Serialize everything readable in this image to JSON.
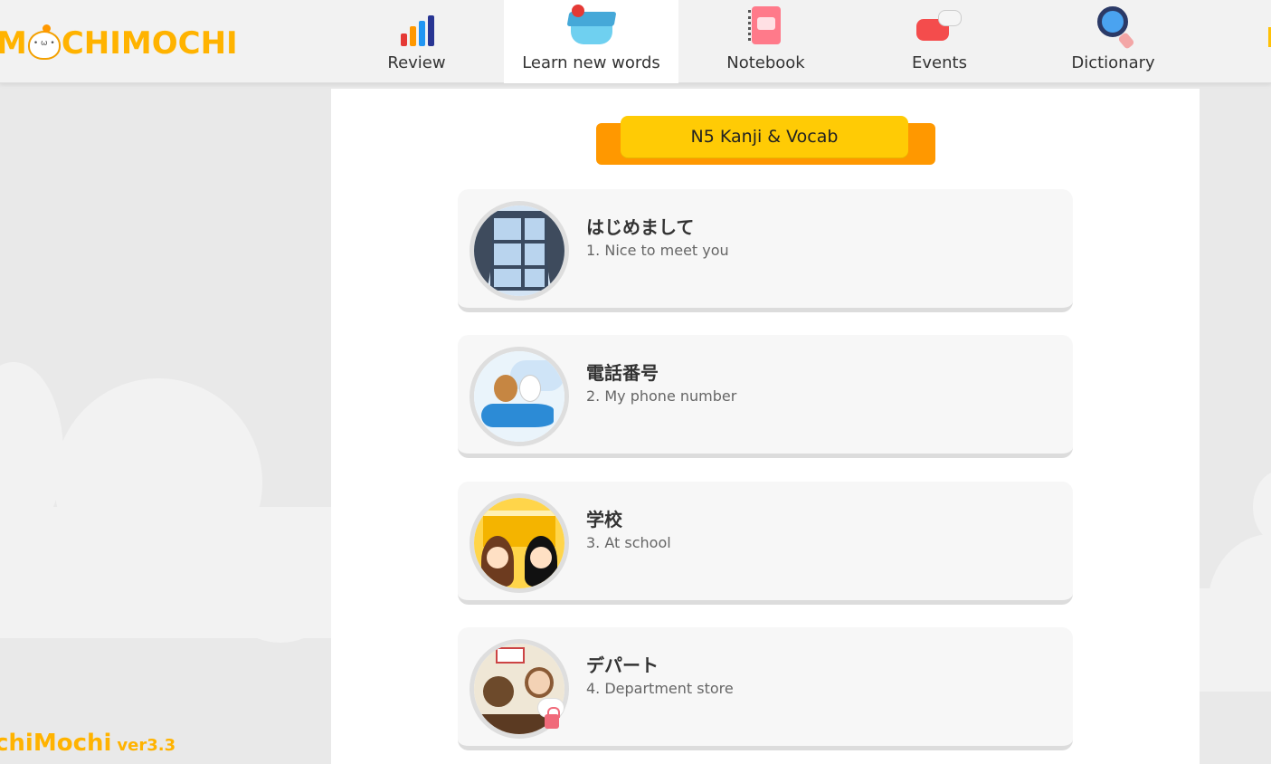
{
  "brand": {
    "logo_text_before": "M",
    "logo_text_after": "CHIMOCHI",
    "version_name": "chiMochi",
    "version_label": "ver3.3",
    "accent_color": "#ffb300"
  },
  "nav": {
    "items": [
      {
        "label": "Review",
        "icon": "bar-chart-icon",
        "active": false
      },
      {
        "label": "Learn new words",
        "icon": "graduation-cap-icon",
        "active": true
      },
      {
        "label": "Notebook",
        "icon": "notebook-icon",
        "active": false
      },
      {
        "label": "Events",
        "icon": "chat-bubbles-icon",
        "active": false
      },
      {
        "label": "Dictionary",
        "icon": "magnifier-icon",
        "active": false
      }
    ]
  },
  "course": {
    "title": "N5 Kanji & Vocab",
    "ribbon_color": "#ffcb05"
  },
  "lessons": [
    {
      "title": "はじめまして",
      "subtitle": "1. Nice to meet you",
      "image": "window-icon",
      "locked": false
    },
    {
      "title": "電話番号",
      "subtitle": "2. My phone number",
      "image": "bear-bunny-fish-icon",
      "locked": false
    },
    {
      "title": "学校",
      "subtitle": "3. At school",
      "image": "school-students-icon",
      "locked": false
    },
    {
      "title": "デパート",
      "subtitle": "4. Department store",
      "image": "shop-counter-icon",
      "locked": true
    }
  ]
}
